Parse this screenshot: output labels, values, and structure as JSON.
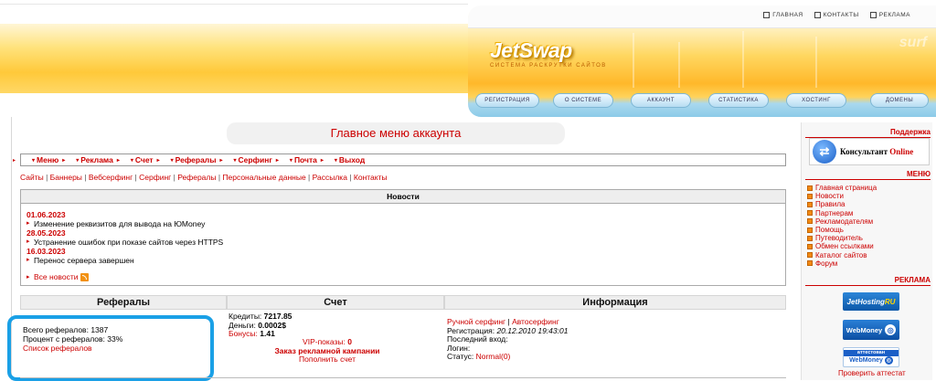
{
  "header": {
    "top_links": [
      {
        "label": "ГЛАВНАЯ",
        "icon": "home-icon"
      },
      {
        "label": "КОНТАКТЫ",
        "icon": "mail-icon"
      },
      {
        "label": "РЕКЛАМА",
        "icon": "ad-icon"
      }
    ],
    "logo": "JetSwap",
    "logo_sub": "СИСТЕМА РАСКРУТКИ САЙТОВ",
    "surf": "surf",
    "nav": [
      "РЕГИСТРАЦИЯ",
      "О СИСТЕМЕ",
      "АККАУНТ",
      "СТАТИСТИКА",
      "ХОСТИНГ",
      "ДОМЕНЫ"
    ]
  },
  "page_title": "Главное меню аккаунта",
  "menu": [
    "Меню",
    "Реклама",
    "Счет",
    "Рефералы",
    "Серфинг",
    "Почта",
    "Выход"
  ],
  "sublinks": [
    "Сайты",
    "Баннеры",
    "Вебсерфинг",
    "Серфинг",
    "Рефералы",
    "Персональные данные",
    "Рассылка",
    "Контакты"
  ],
  "news": {
    "title": "Новости",
    "items": [
      {
        "date": "01.06.2023",
        "text": "Изменение реквизитов для вывода на ЮMoney"
      },
      {
        "date": "28.05.2023",
        "text": "Устранение ошибок при показе сайтов через HTTPS"
      },
      {
        "date": "16.03.2023",
        "text": "Перенос сервера завершен"
      }
    ],
    "all_link": "Все новости"
  },
  "referrals": {
    "title": "Рефералы",
    "total_label": "Всего рефералов:",
    "total_value": "1387",
    "percent_label": "Процент с рефералов:",
    "percent_value": "33%",
    "list_link": "Список рефералов"
  },
  "account": {
    "title": "Счет",
    "credits_label": "Кредиты:",
    "credits_value": "7217.85",
    "money_label": "Деньги:",
    "money_value": "0.0002$",
    "bonus_label": "Бонусы:",
    "bonus_value": "1.41",
    "vip_label": "VIP-показы:",
    "vip_value": "0",
    "order_link": "Заказ рекламной кампании",
    "refill_link": "Пополнить счет"
  },
  "info": {
    "title": "Информация",
    "manual_surf": "Ручной серфинг",
    "auto_surf": "Автосерфинг",
    "reg_label": "Регистрация:",
    "reg_value": "20.12.2010 19:43:01",
    "last_login_label": "Последний вход:",
    "login_label": "Логин:",
    "status_label": "Статус:",
    "status_value": "Normal(0)"
  },
  "sidebar": {
    "support_title": "Поддержка",
    "consult_text": "Консультант",
    "consult_online": "Online",
    "menu_title": "МЕНЮ",
    "menu_items": [
      "Главная страница",
      "Новости",
      "Правила",
      "Партнерам",
      "Рекламодателям",
      "Помощь",
      "Путеводитель",
      "Обмен ссылками",
      "Каталог сайтов",
      "Форум"
    ],
    "ads_title": "РЕКЛАМА",
    "jethosting": "JetHosting",
    "jethosting_ru": "RU",
    "webmoney": "WebMoney",
    "attested": "аттестован",
    "check_attestat": "Проверить аттестат"
  },
  "colors": {
    "accent": "#cc0000",
    "highlight": "#1aa0e6",
    "header_orange": "#ffc93a"
  }
}
